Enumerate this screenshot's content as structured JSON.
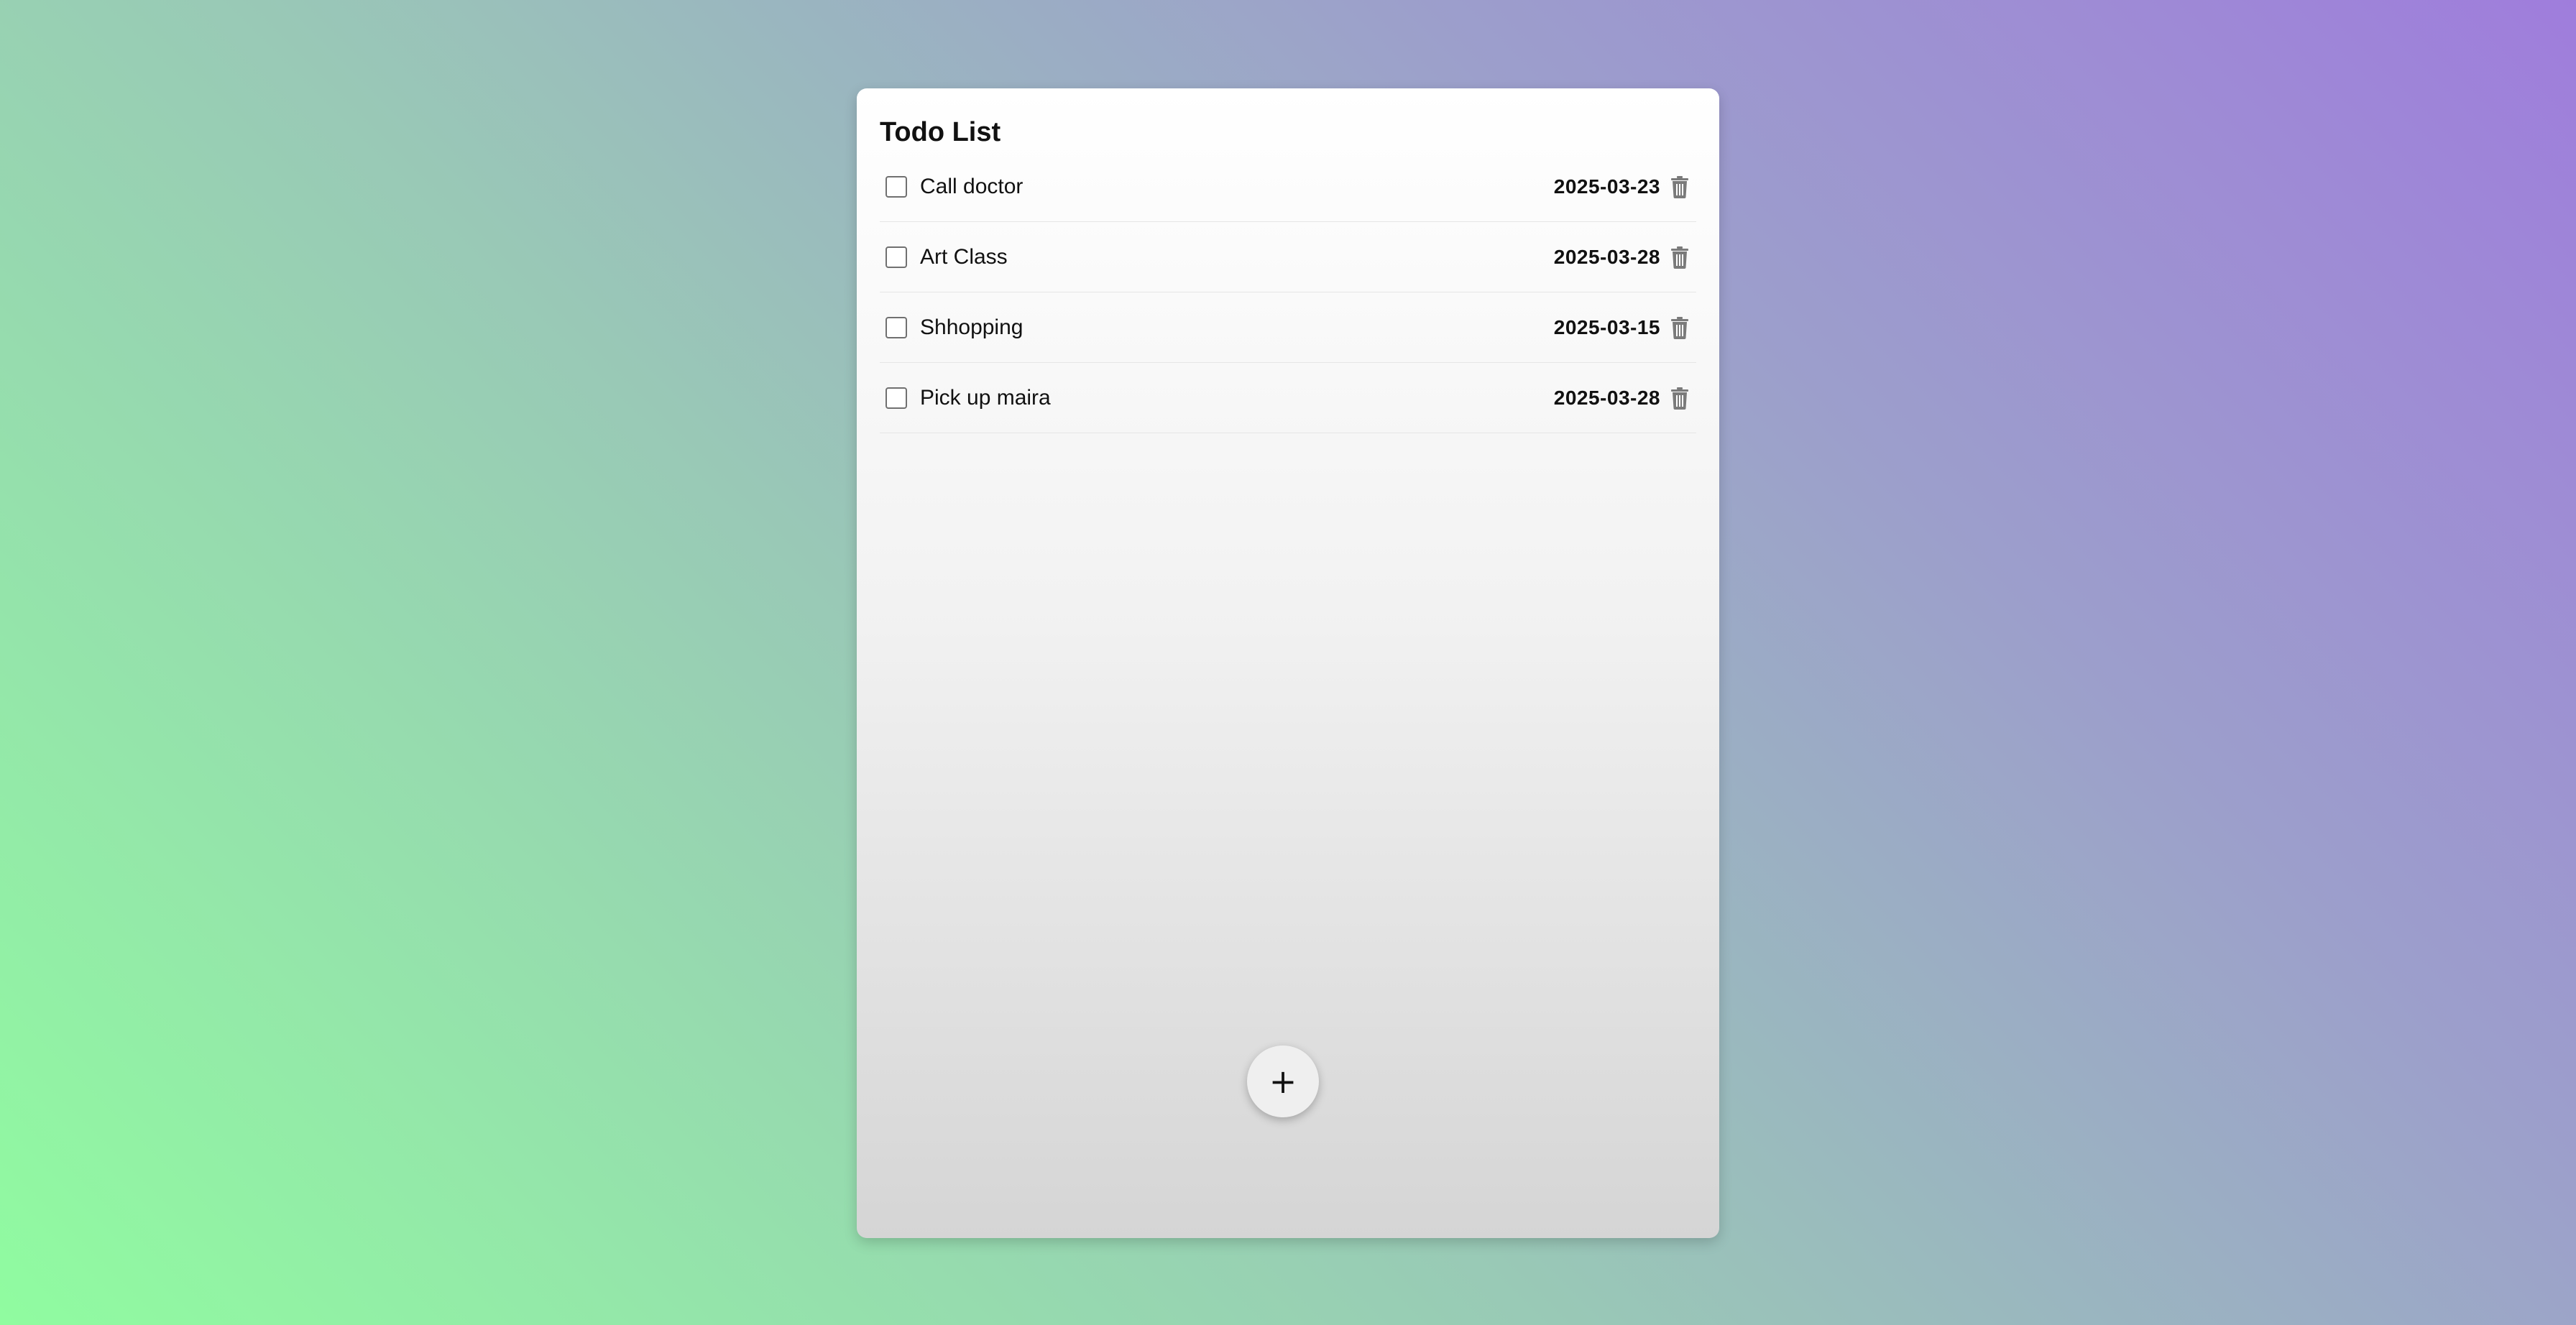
{
  "app": {
    "title": "Todo List",
    "add_button_label": "+"
  },
  "todos": [
    {
      "text": "Call doctor",
      "date": "2025-03-23",
      "checked": false
    },
    {
      "text": "Art Class",
      "date": "2025-03-28",
      "checked": false
    },
    {
      "text": "Shhopping",
      "date": "2025-03-15",
      "checked": false
    },
    {
      "text": "Pick up maira",
      "date": "2025-03-28",
      "checked": false
    }
  ],
  "icons": {
    "delete": "trash-icon",
    "add": "plus-icon"
  },
  "colors": {
    "gradient_start": "#90fca0",
    "gradient_end": "#9f7ddc",
    "trash": "#7a7a7a"
  }
}
